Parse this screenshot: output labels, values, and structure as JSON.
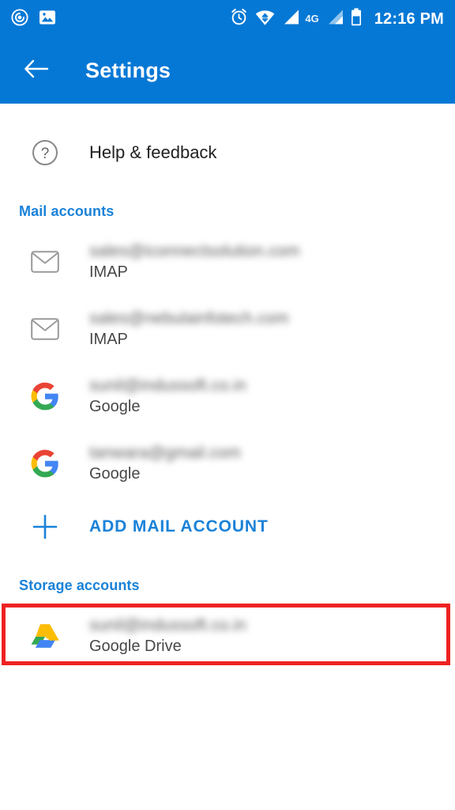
{
  "statusbar": {
    "time": "12:16 PM",
    "network_label": "4G",
    "left_icons": [
      {
        "name": "app-circle-icon"
      },
      {
        "name": "photo-icon"
      }
    ],
    "right_icons": [
      {
        "name": "alarm-icon"
      },
      {
        "name": "wifi-icon"
      },
      {
        "name": "signal-bars-icon"
      },
      {
        "name": "signal-bars-2-icon"
      },
      {
        "name": "battery-icon"
      }
    ]
  },
  "toolbar": {
    "title": "Settings",
    "back_icon": "back-arrow-icon"
  },
  "help": {
    "label": "Help & feedback",
    "icon": "help-circle-icon"
  },
  "mail_section": {
    "header": "Mail accounts",
    "accounts": [
      {
        "email": "sales@iconnectsolution.com",
        "type": "IMAP",
        "icon": "envelope-icon"
      },
      {
        "email": "sales@nebulainfotech.com",
        "type": "IMAP",
        "icon": "envelope-icon"
      },
      {
        "email": "sunil@indussoft.co.in",
        "type": "Google",
        "icon": "google-logo-icon"
      },
      {
        "email": "tanwara@gmail.com",
        "type": "Google",
        "icon": "google-logo-icon"
      }
    ],
    "add_button": {
      "label": "ADD MAIL ACCOUNT",
      "icon": "plus-icon"
    }
  },
  "storage_section": {
    "header": "Storage accounts",
    "accounts": [
      {
        "email": "sunil@indussoft.co.in",
        "type": "Google Drive",
        "icon": "google-drive-icon"
      }
    ]
  },
  "colors": {
    "primary_blue": "#0578D5",
    "accent_blue": "#1a82d8",
    "annotation_red": "#ee2222",
    "text_primary": "#212121",
    "text_secondary": "#474747"
  },
  "annotation": {
    "target": "ADD MAIL ACCOUNT",
    "shape": "rectangle"
  }
}
